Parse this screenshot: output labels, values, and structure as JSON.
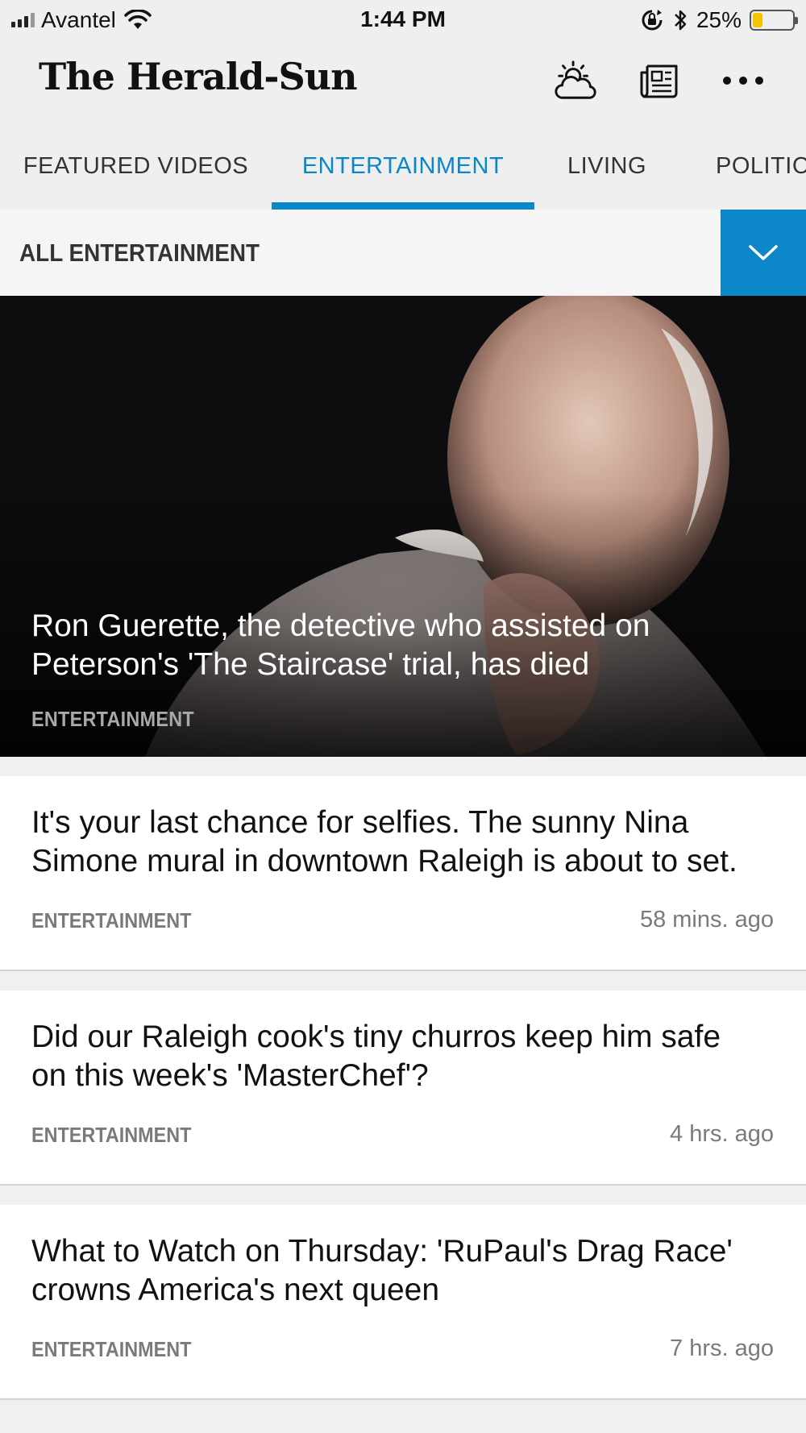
{
  "status_bar": {
    "carrier": "Avantel",
    "time": "1:44 PM",
    "battery_percent": "25%",
    "battery_level": 0.25,
    "icons": [
      "signal-icon",
      "wifi-icon",
      "orientation-lock-icon",
      "bluetooth-icon",
      "battery-icon"
    ]
  },
  "header": {
    "logo_text": "The Herald-Sun",
    "icons": [
      "weather-icon",
      "newspaper-icon",
      "more-icon"
    ]
  },
  "tabs": [
    {
      "label": "FEATURED VIDEOS",
      "active": false
    },
    {
      "label": "ENTERTAINMENT",
      "active": true
    },
    {
      "label": "LIVING",
      "active": false
    },
    {
      "label": "POLITIC",
      "active": false
    }
  ],
  "section": {
    "label": "ALL ENTERTAINMENT",
    "toggle_icon": "chevron-down-icon"
  },
  "hero": {
    "title": "Ron Guerette, the detective who assisted on Peterson's 'The Staircase' trial, has died",
    "category": "ENTERTAINMENT"
  },
  "articles": [
    {
      "title": "It's your last chance for selfies. The sunny Nina Simone mural in downtown Raleigh is about to set.",
      "category": "ENTERTAINMENT",
      "time": "58 mins. ago"
    },
    {
      "title": "Did our Raleigh cook's tiny churros keep him safe on this week's 'MasterChef'?",
      "category": "ENTERTAINMENT",
      "time": "4 hrs. ago"
    },
    {
      "title": "What to Watch on Thursday: 'RuPaul's Drag Race' crowns America's next queen",
      "category": "ENTERTAINMENT",
      "time": "7 hrs. ago"
    }
  ],
  "colors": {
    "accent": "#0a86c9",
    "background": "#efefef",
    "muted_text": "#7a7a7a"
  }
}
